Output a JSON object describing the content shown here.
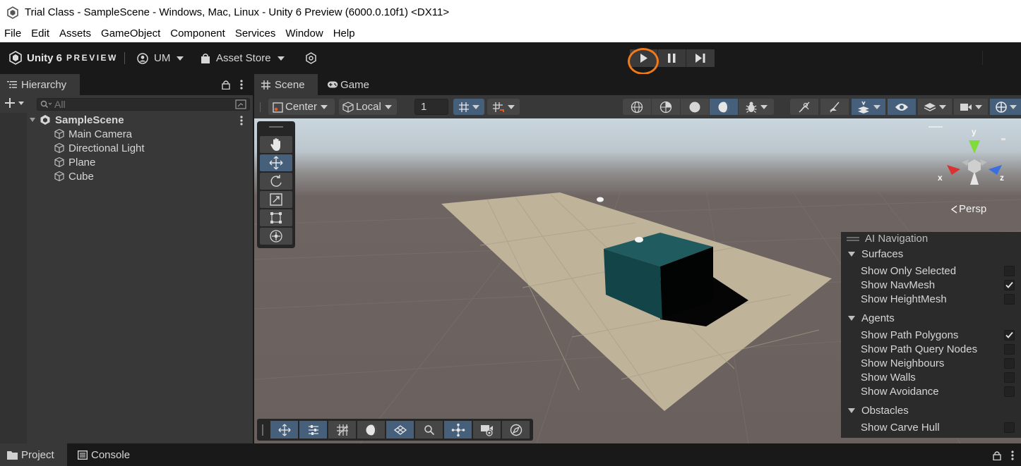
{
  "window": {
    "title": "Trial Class - SampleScene - Windows, Mac, Linux - Unity 6 Preview (6000.0.10f1) <DX11>"
  },
  "menu": [
    "File",
    "Edit",
    "Assets",
    "GameObject",
    "Component",
    "Services",
    "Window",
    "Help"
  ],
  "toolbar": {
    "brand": "Unity 6",
    "brand_suffix": "PREVIEW",
    "account": "UM",
    "asset_store": "Asset Store"
  },
  "hierarchy": {
    "tab": "Hierarchy",
    "search_placeholder": "All",
    "scene": "SampleScene",
    "items": [
      "Main Camera",
      "Directional Light",
      "Plane",
      "Cube"
    ]
  },
  "scene_tabs": {
    "scene": "Scene",
    "game": "Game"
  },
  "scene_toolbar": {
    "pivot": "Center",
    "space": "Local",
    "grid_size": "1"
  },
  "gizmo": {
    "projection": "Persp",
    "x": "x",
    "y": "y",
    "z": "z"
  },
  "ai_navigation": {
    "title": "AI Navigation",
    "sections": [
      {
        "label": "Surfaces",
        "items": [
          {
            "label": "Show Only Selected",
            "checked": false
          },
          {
            "label": "Show NavMesh",
            "checked": true
          },
          {
            "label": "Show HeightMesh",
            "checked": false
          }
        ]
      },
      {
        "label": "Agents",
        "items": [
          {
            "label": "Show Path Polygons",
            "checked": true
          },
          {
            "label": "Show Path Query Nodes",
            "checked": false
          },
          {
            "label": "Show Neighbours",
            "checked": false
          },
          {
            "label": "Show Walls",
            "checked": false
          },
          {
            "label": "Show Avoidance",
            "checked": false
          }
        ]
      },
      {
        "label": "Obstacles",
        "items": [
          {
            "label": "Show Carve Hull",
            "checked": false
          }
        ]
      }
    ]
  },
  "bottom_tabs": {
    "project": "Project",
    "console": "Console"
  },
  "colors": {
    "accent_blue": "#46607c",
    "play_highlight": "#f07a1a",
    "cube": "#1f5b5f",
    "plane": "#bfb39a"
  }
}
